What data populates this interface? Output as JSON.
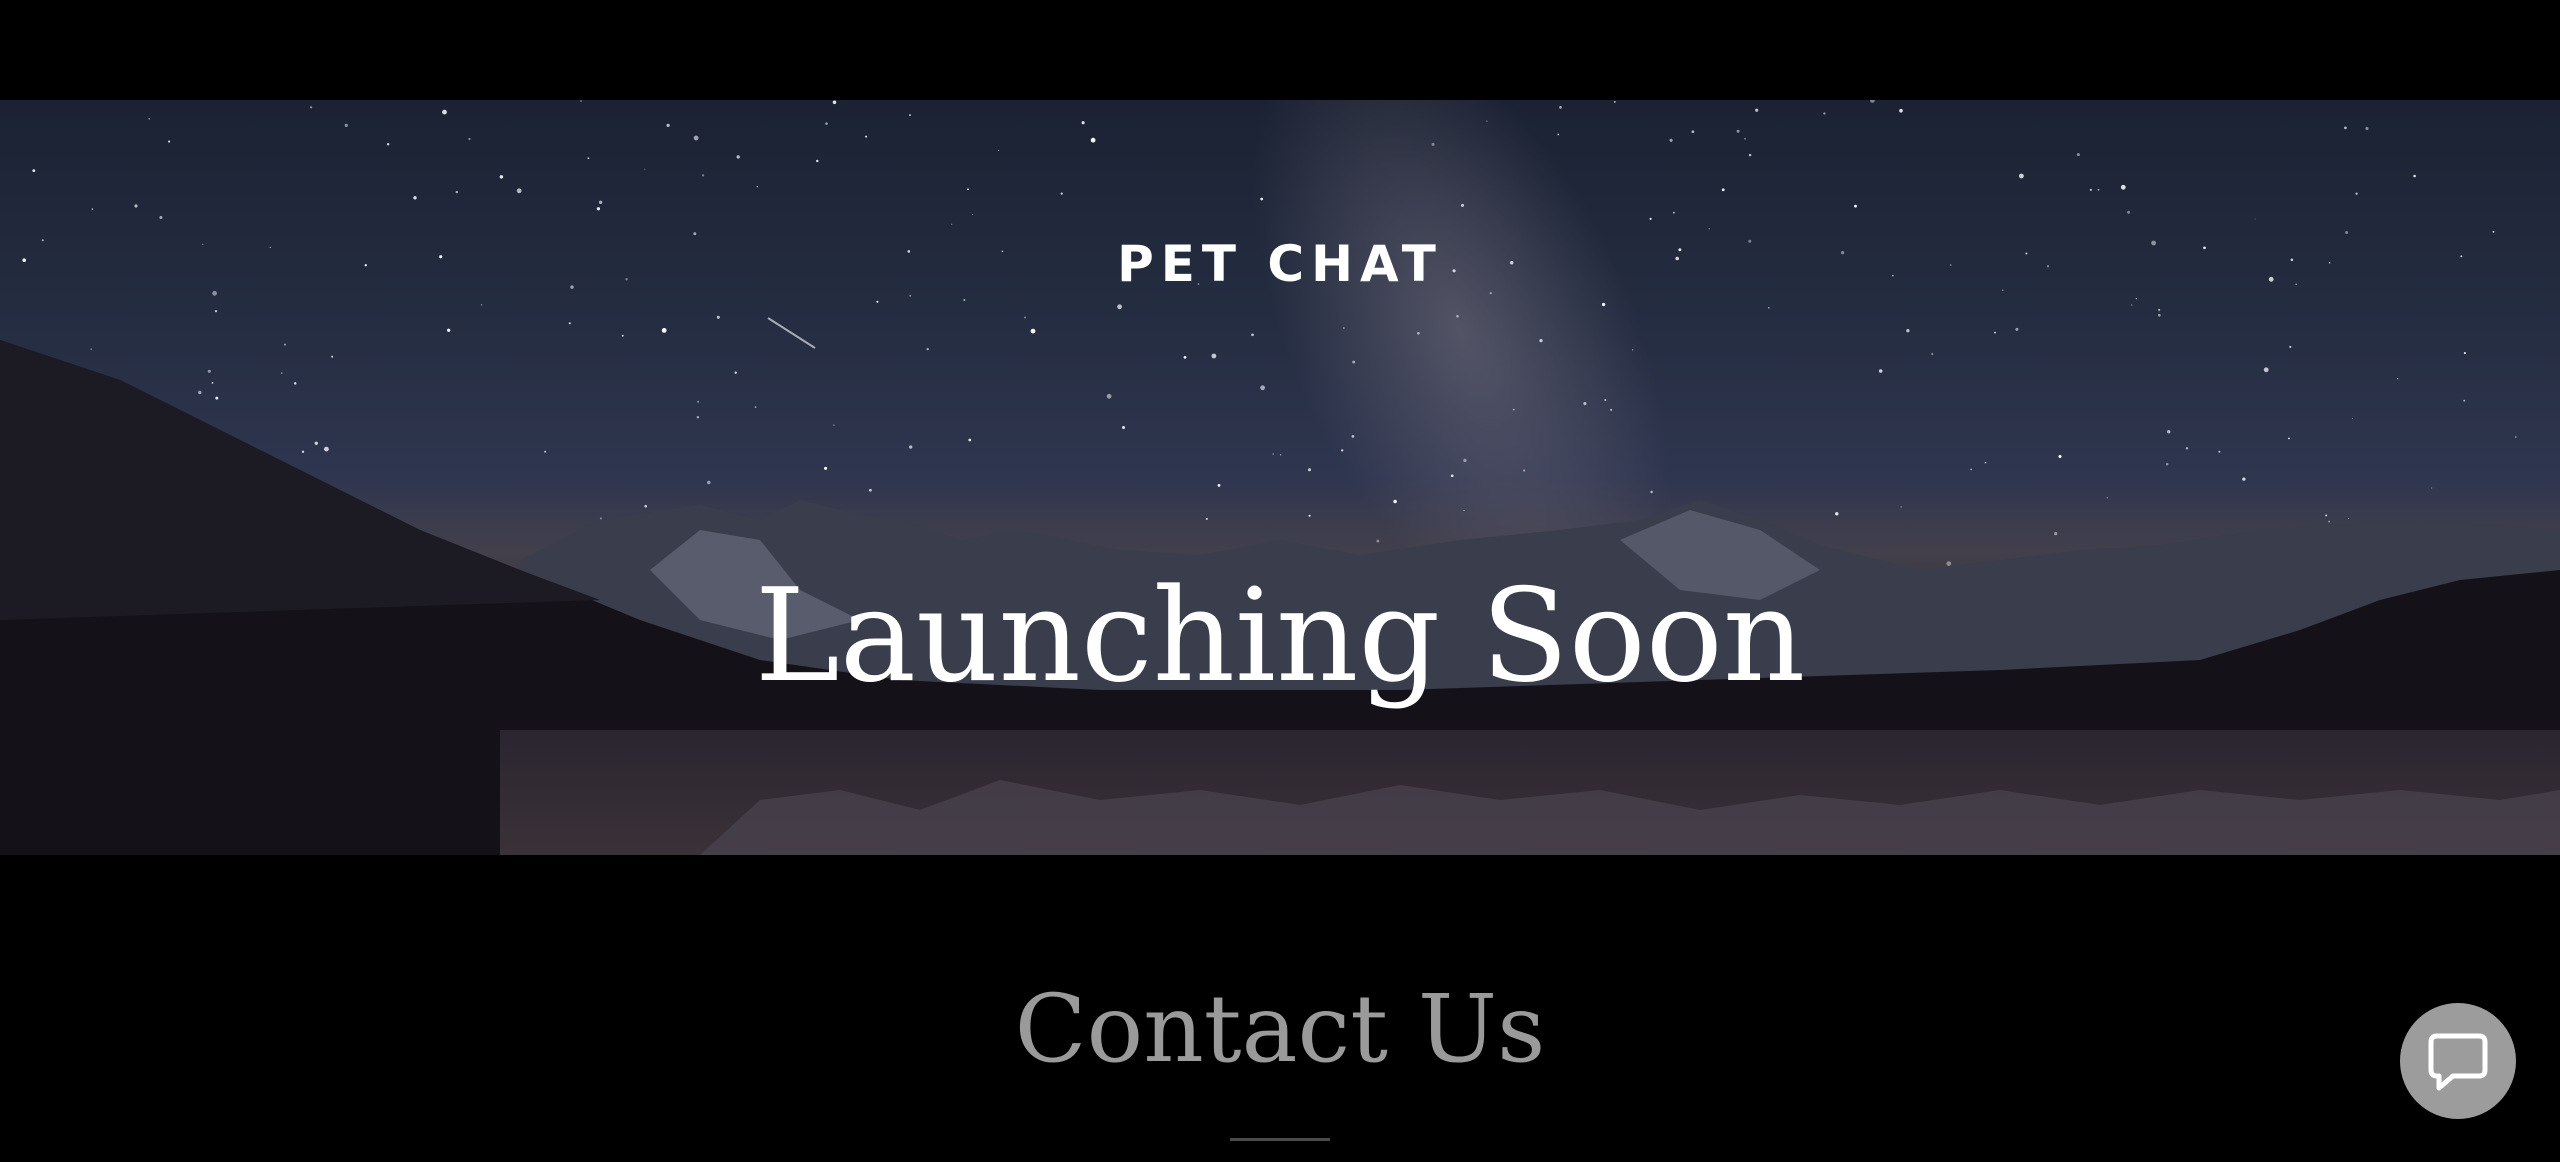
{
  "header": {
    "brand": "PET CHAT"
  },
  "hero": {
    "headline": "Launching Soon"
  },
  "contact": {
    "heading": "Contact Us"
  },
  "chat_widget": {
    "icon": "chat-bubble-icon"
  },
  "colors": {
    "background": "#000000",
    "hero_text": "#ffffff",
    "contact_heading": "#9a9a9a",
    "chat_button": "#9c9c9c"
  }
}
